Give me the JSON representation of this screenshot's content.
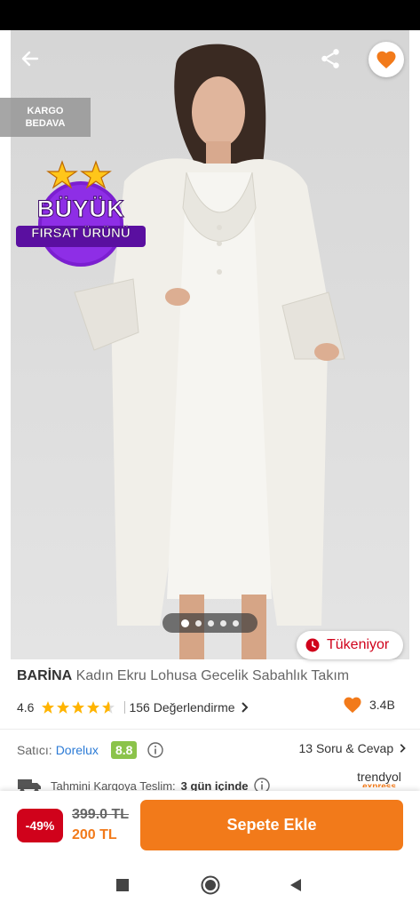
{
  "hero": {
    "cargo_badge": [
      "KARGO",
      "BEDAVA"
    ],
    "deal_badge": [
      "BÜYÜK",
      "FIRSAT ÜRÜNÜ"
    ],
    "image_count": 5,
    "active_image_index": 0,
    "stock_status": "Tükeniyor"
  },
  "product": {
    "brand": "BARİNA",
    "name": "Kadın Ekru Lohusa Gecelik Sabahlık Takım",
    "rating": "4.6",
    "rating_value": 4.6,
    "reviews": "156 Değerlendirme",
    "favorites": "3.4B"
  },
  "seller": {
    "label": "Satıcı:",
    "name": "Dorelux",
    "score": "8.8",
    "qa": "13 Soru & Cevap"
  },
  "delivery": {
    "label": "Tahmini Kargoya Teslim:",
    "value": "3 gün içinde",
    "logo_top": "trendyol",
    "logo_bottom": "express"
  },
  "purchase": {
    "discount": "-49%",
    "old_price": "399.0 TL",
    "new_price": "200 TL",
    "add_to_cart": "Sepete Ekle"
  },
  "colors": {
    "accent": "#f27a1a",
    "discount_red": "#d0021b",
    "seller_link": "#2c7bd6",
    "score_green": "#8bc34a"
  },
  "icons": [
    "back-arrow-icon",
    "share-icon",
    "heart-icon",
    "clock-icon",
    "star-icon",
    "info-icon",
    "truck-icon",
    "chevron-right-icon",
    "recent-apps-icon",
    "home-icon",
    "back-icon"
  ]
}
